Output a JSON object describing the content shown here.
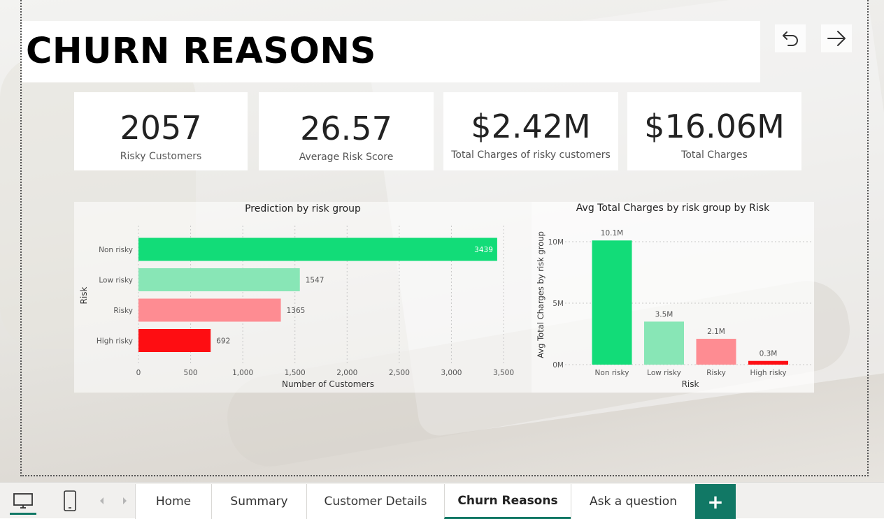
{
  "page": {
    "title": "CHURN REASONS"
  },
  "nav": {
    "back_icon": "undo-icon",
    "forward_icon": "arrow-right-icon"
  },
  "kpis": [
    {
      "value": "2057",
      "label": "Risky Customers"
    },
    {
      "value": "26.57",
      "label": "Average Risk Score"
    },
    {
      "value": "$2.42M",
      "label": "Total Charges of risky customers"
    },
    {
      "value": "$16.06M",
      "label": "Total Charges"
    }
  ],
  "colors": {
    "non_risky": "#12dc78",
    "low_risky": "#88e6b6",
    "risky": "#fe8c92",
    "high_risky": "#fe0d12",
    "accent": "#117865"
  },
  "chart_data": [
    {
      "type": "bar",
      "orientation": "horizontal",
      "title": "Prediction by risk group",
      "xlabel": "Number of Customers",
      "ylabel": "Risk",
      "categories": [
        "Non risky",
        "Low risky",
        "Risky",
        "High risky"
      ],
      "values": [
        3439,
        1547,
        1365,
        692
      ],
      "value_labels": [
        "3439",
        "1547",
        "1365",
        "692"
      ],
      "xlim": [
        0,
        3500
      ],
      "xticks": [
        0,
        500,
        1000,
        1500,
        2000,
        2500,
        3000,
        3500
      ],
      "xtick_labels": [
        "0",
        "500",
        "1,000",
        "1,500",
        "2,000",
        "2,500",
        "3,000",
        "3,500"
      ],
      "grid": true
    },
    {
      "type": "bar",
      "orientation": "vertical",
      "title": "Avg Total Charges by risk group by Risk",
      "xlabel": "Risk",
      "ylabel": "Avg Total Charges by risk group",
      "categories": [
        "Non risky",
        "Low risky",
        "Risky",
        "High risky"
      ],
      "values": [
        10.1,
        3.5,
        2.1,
        0.3
      ],
      "value_labels": [
        "10.1M",
        "3.5M",
        "2.1M",
        "0.3M"
      ],
      "ylim": [
        0,
        10
      ],
      "yticks": [
        0,
        5,
        10
      ],
      "ytick_labels": [
        "0M",
        "5M",
        "10M"
      ],
      "grid": true
    }
  ],
  "bottom_bar": {
    "desktop_icon": "desktop-icon",
    "mobile_icon": "mobile-icon",
    "prev_icon": "chevron-left-icon",
    "next_icon": "chevron-right-icon",
    "tabs": [
      {
        "label": "Home"
      },
      {
        "label": "Summary"
      },
      {
        "label": "Customer Details"
      },
      {
        "label": "Churn Reasons"
      },
      {
        "label": "Ask a question"
      }
    ],
    "add_label": "+"
  }
}
